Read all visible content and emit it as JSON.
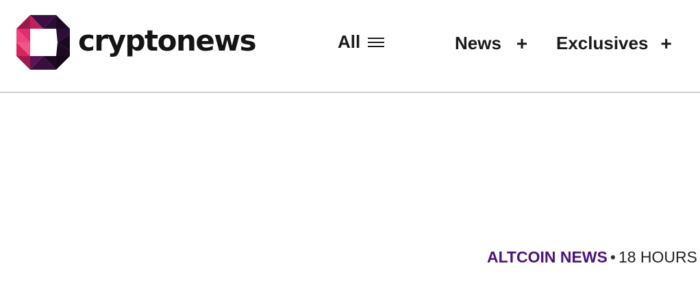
{
  "header": {
    "brand": "cryptonews",
    "nav": {
      "all_label": "All",
      "items": [
        {
          "label": "News",
          "icon": "plus-icon"
        },
        {
          "label": "Exclusives",
          "icon": "plus-icon"
        }
      ]
    }
  },
  "article": {
    "category": "ALTCOIN NEWS",
    "separator": "•",
    "time": "18 HOURS"
  },
  "colors": {
    "category": "#4a1283",
    "text": "#1a1a1a",
    "divider": "#cfcfcf"
  }
}
